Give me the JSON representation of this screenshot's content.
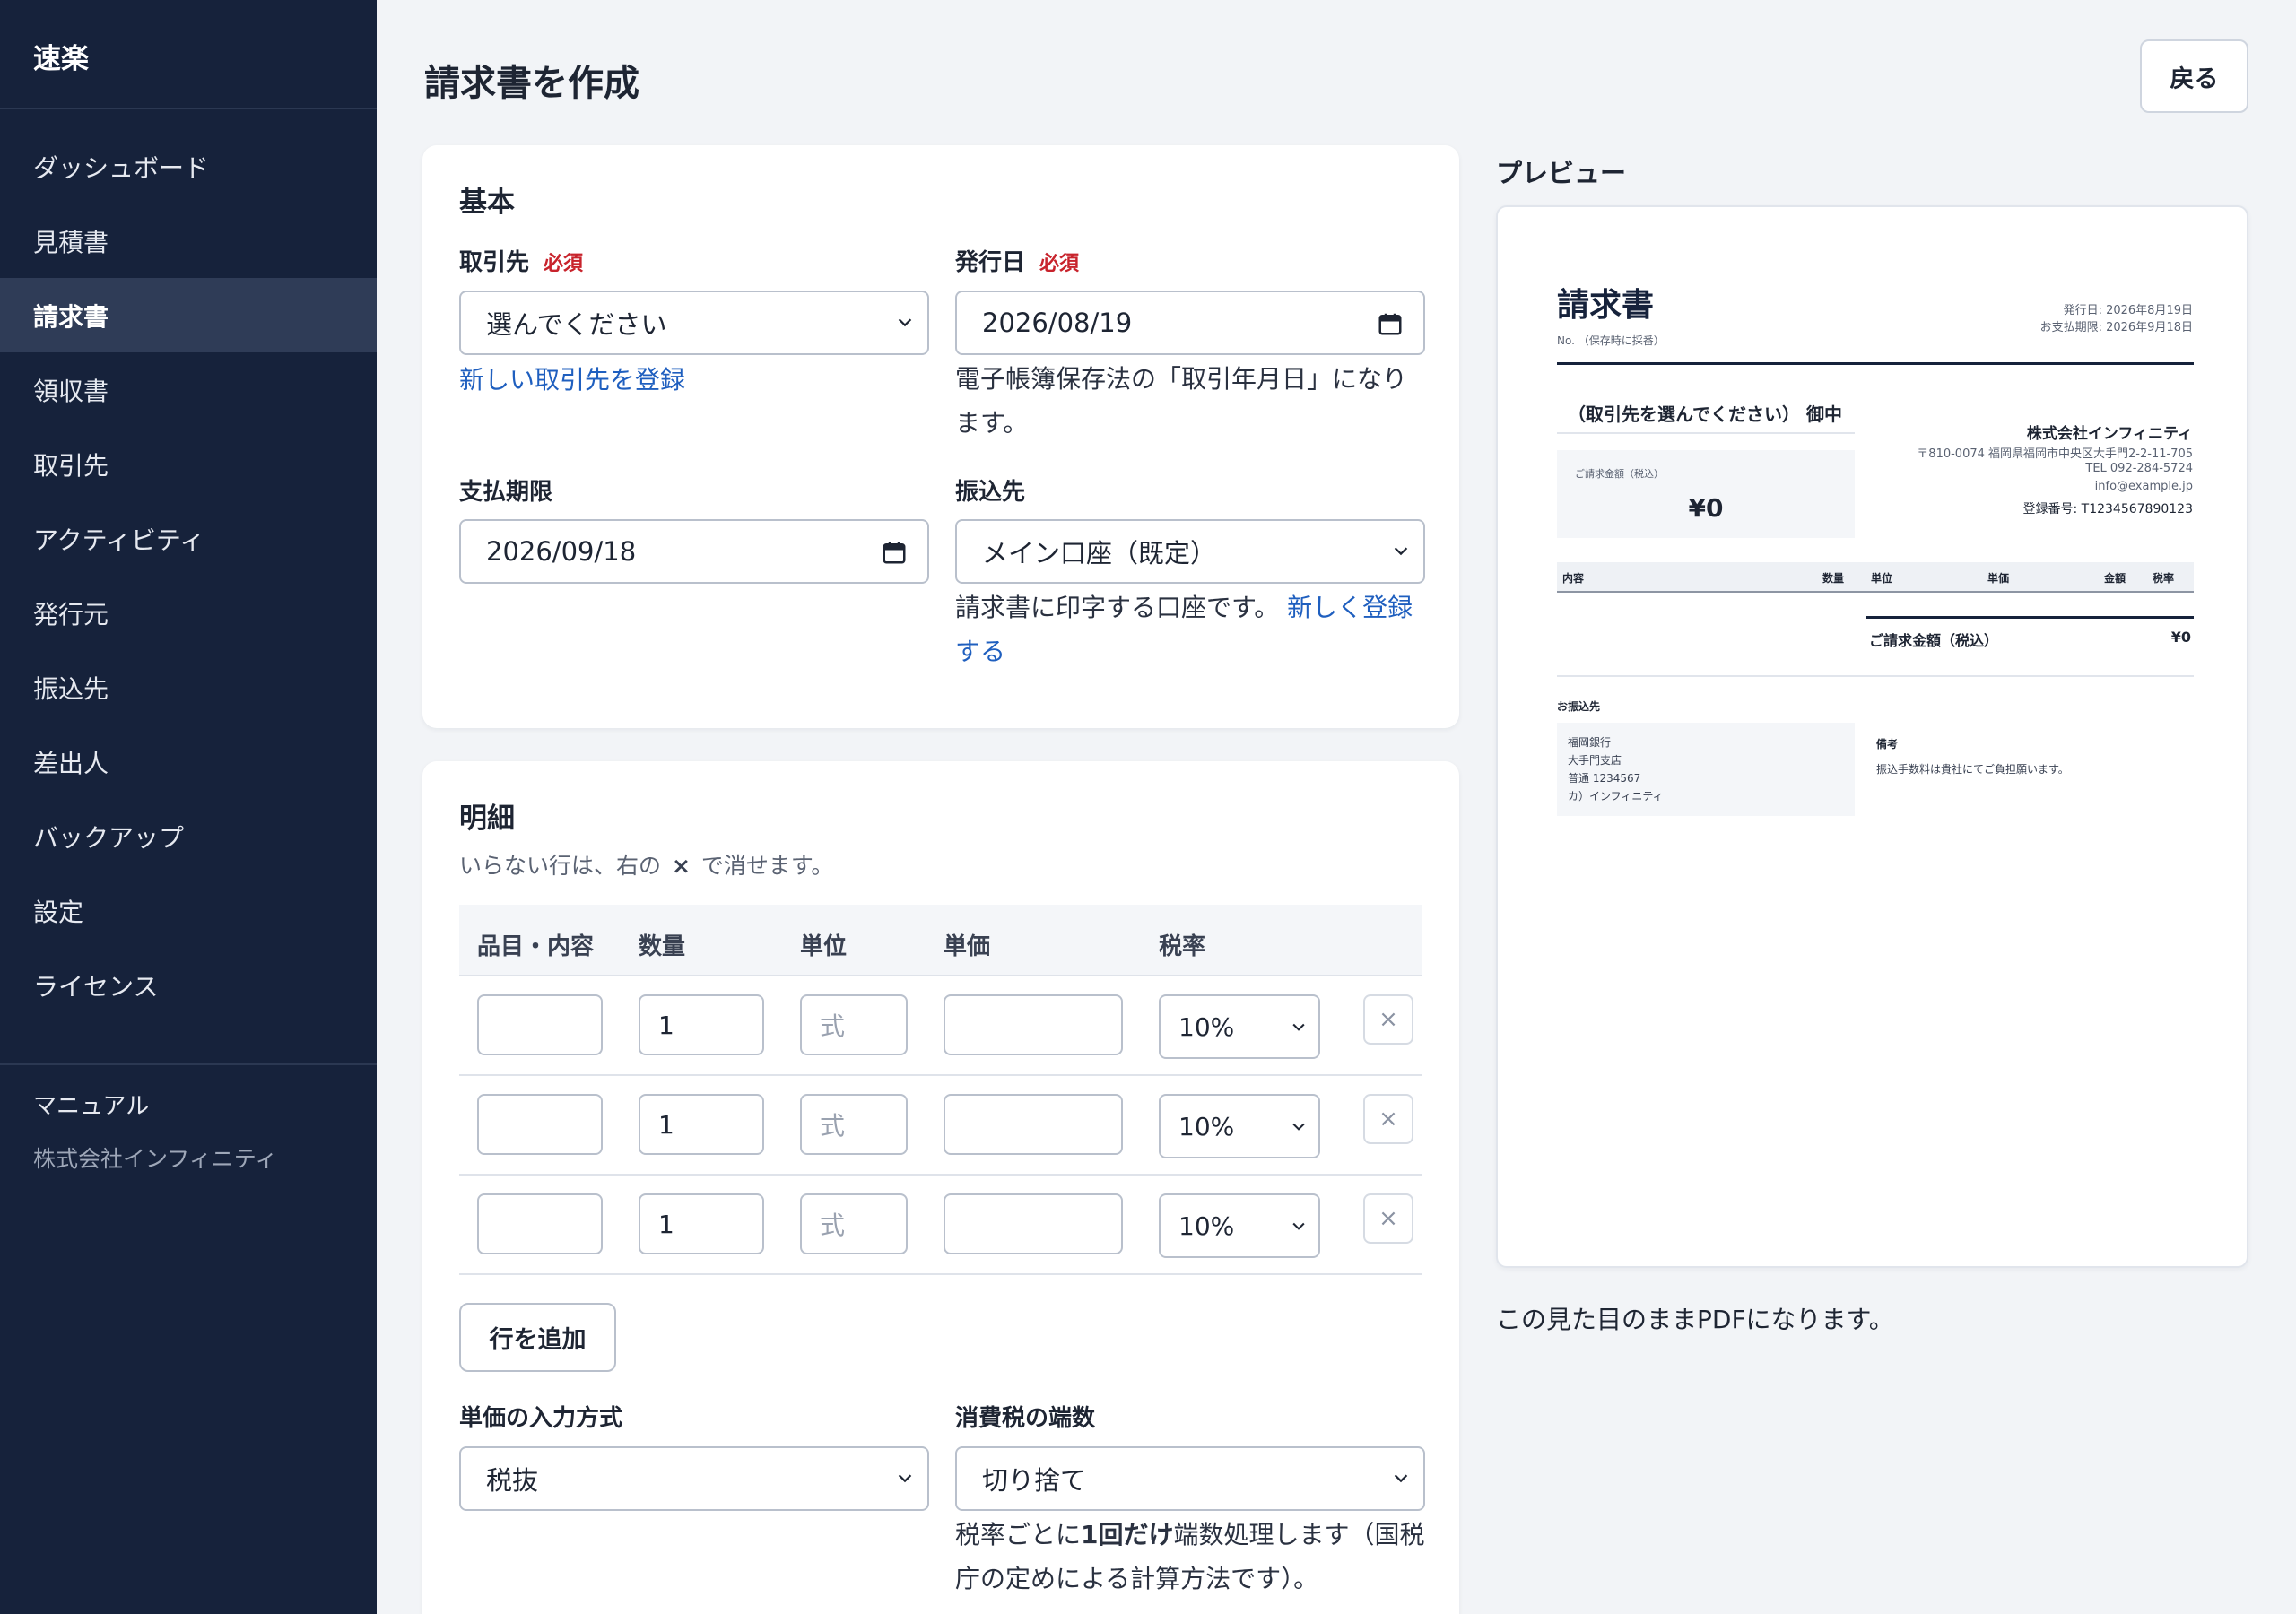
{
  "app": {
    "brand": "速楽"
  },
  "sidebar": {
    "items": [
      {
        "label": "ダッシュボード"
      },
      {
        "label": "見積書"
      },
      {
        "label": "請求書"
      },
      {
        "label": "領収書"
      },
      {
        "label": "取引先"
      },
      {
        "label": "アクティビティ"
      },
      {
        "label": "発行元"
      },
      {
        "label": "振込先"
      },
      {
        "label": "差出人"
      },
      {
        "label": "バックアップ"
      },
      {
        "label": "設定"
      },
      {
        "label": "ライセンス"
      }
    ],
    "active_index": 2,
    "manual_label": "マニュアル",
    "company": "株式会社インフィニティ"
  },
  "header": {
    "title": "請求書を作成",
    "back_label": "戻る"
  },
  "basic": {
    "title": "基本",
    "required_badge": "必須",
    "client_label": "取引先",
    "client_value": "選んでください",
    "client_register_link": "新しい取引先を登録",
    "issue_date_label": "発行日",
    "issue_date_value": "2026/08/19",
    "issue_date_help": "電子帳簿保存法の「取引年月日」になります。",
    "due_label": "支払期限",
    "due_value": "2026/09/18",
    "bank_label": "振込先",
    "bank_value": "メイン口座（既定）",
    "bank_help": "請求書に印字する口座です。",
    "bank_register_link": "新しく登録する"
  },
  "detail": {
    "title": "明細",
    "hint_prefix": "いらない行は、右の",
    "hint_icon": "×",
    "hint_suffix": "で消せます。",
    "columns": [
      "品目・内容",
      "数量",
      "単位",
      "単価",
      "税率"
    ],
    "rows": [
      {
        "item": "",
        "qty": "1",
        "unit_placeholder": "式",
        "price": "",
        "rate": "10%"
      },
      {
        "item": "",
        "qty": "1",
        "unit_placeholder": "式",
        "price": "",
        "rate": "10%"
      },
      {
        "item": "",
        "qty": "1",
        "unit_placeholder": "式",
        "price": "",
        "rate": "10%"
      }
    ],
    "delete_glyph": "×",
    "add_row_label": "行を追加",
    "price_mode_label": "単価の入力方式",
    "price_mode_value": "税抜",
    "rounding_label": "消費税の端数",
    "rounding_value": "切り捨て",
    "rounding_help_1": "税率ごとに",
    "rounding_help_bold": "1回だけ",
    "rounding_help_2": "端数処理します（国税庁の定めによる計算方法です）。"
  },
  "preview": {
    "title": "プレビュー",
    "doc_title": "請求書",
    "doc_no": "No. （保存時に採番）",
    "issue_line": "発行日: 2026年8月19日",
    "due_line": "お支払期限: 2026年9月18日",
    "client_line": "（取引先を選んでください） 御中",
    "amount_label": "ご請求金額（税込）",
    "amount_value": "¥0",
    "issuer_name": "株式会社インフィニティ",
    "issuer_address": "〒810-0074 福岡県福岡市中央区大手門2-2-11-705",
    "issuer_tel": "TEL 092-284-5724",
    "issuer_email": "info@example.jp",
    "issuer_reg": "登録番号: T1234567890123",
    "table_headers": [
      "内容",
      "数量",
      "単位",
      "単価",
      "金額",
      "税率"
    ],
    "total_label": "ご請求金額（税込）",
    "total_value": "¥0",
    "bank_heading": "お振込先",
    "bank_lines": [
      "福岡銀行",
      "大手門支店",
      "普通 1234567",
      "カ）インフィニティ"
    ],
    "remarks_heading": "備考",
    "remarks_text": "振込手数料は貴社にてご負担願います。",
    "note": "この見た目のままPDFになります。"
  }
}
